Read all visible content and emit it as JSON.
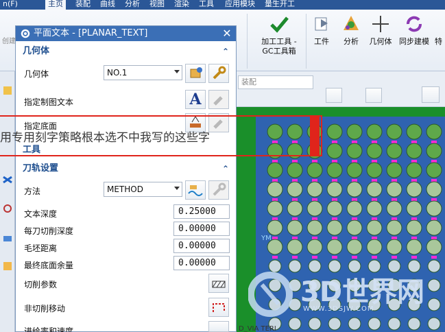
{
  "ribbon_tabs": [
    "n(F)",
    "主页",
    "装配",
    "曲线",
    "分析",
    "视图",
    "渲染",
    "工具",
    "应用模块",
    "量生开工"
  ],
  "ribbon_buttons": {
    "create": "创建",
    "gc_tool": {
      "line1": "加工工具 -",
      "line2": "GC工具箱"
    },
    "part": "工件",
    "analysis": "分析",
    "geometry": "几何体",
    "sync": "同步建模",
    "more": "特"
  },
  "filter_select": "装配",
  "dialog": {
    "title": "平面文本 - [PLANAR_TEXT]",
    "sections": {
      "geometry": "几何体",
      "tool": "工具",
      "toolpath": "刀轨设置"
    },
    "geometry_label": "几何体",
    "geometry_value": "NO.1",
    "drawing_text_label": "指定制图文本",
    "floor_label": "指定底面",
    "method_label": "方法",
    "method_value": "METHOD",
    "text_depth_label": "文本深度",
    "text_depth_value": "0.25000",
    "depth_per_cut_label": "每刀切削深度",
    "depth_per_cut_value": "0.00000",
    "blank_distance_label": "毛坯距离",
    "blank_distance_value": "0.00000",
    "final_floor_stock_label": "最终底面余量",
    "final_floor_stock_value": "0.00000",
    "cut_params_label": "切削参数",
    "non_cut_moves_label": "非切削移动",
    "feeds_speeds_label": "进给率和速度"
  },
  "annotation_text": "用专用刻字策略根本选不中我写的这些字",
  "watermark": {
    "brand": "3D世界网",
    "url": "WWW.3DSJW.COM"
  },
  "viewport_axis": "YM",
  "bottom_text": "D_VIA TERI"
}
